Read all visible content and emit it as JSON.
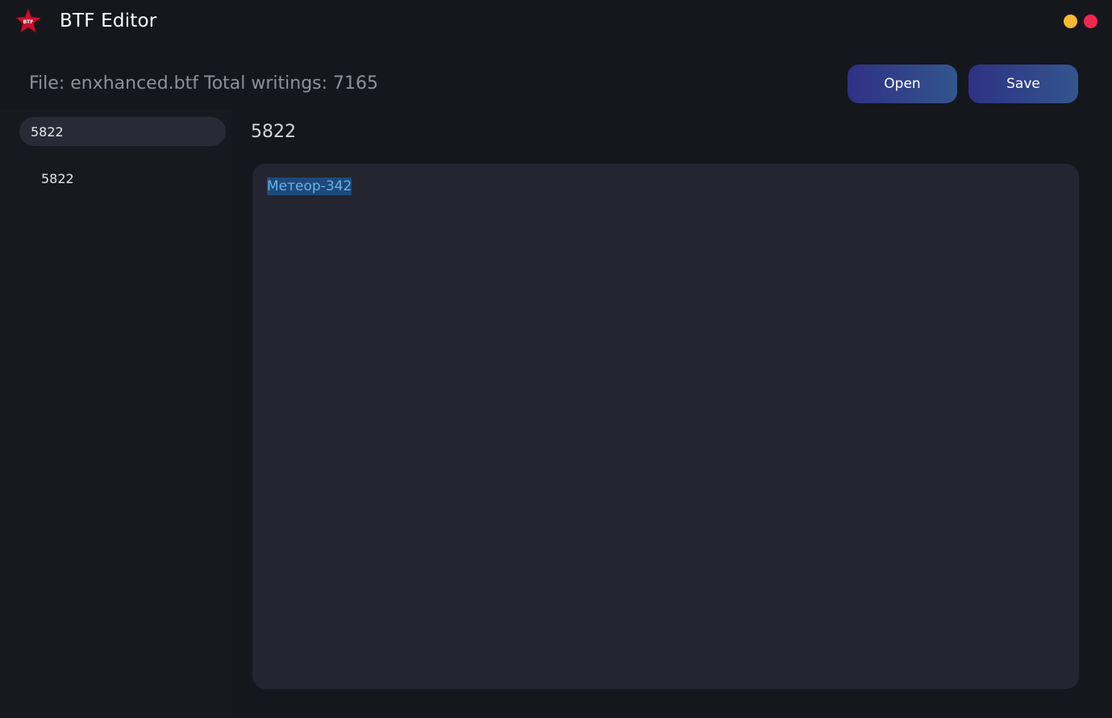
{
  "app": {
    "title": "BTF Editor",
    "logo_text": "BTF"
  },
  "window_controls": {
    "minimize_color": "#f7b731",
    "close_color": "#f0274f"
  },
  "file_info": {
    "file_label": "File: enxhanced.btf",
    "total_label": "Total writings: 7165"
  },
  "toolbar": {
    "open_label": "Open",
    "save_label": "Save"
  },
  "sidebar": {
    "search_value": "5822",
    "items": [
      {
        "label": "5822"
      }
    ]
  },
  "entry": {
    "title": "5822",
    "text": "Метеор-342"
  },
  "colors": {
    "background": "#16171d",
    "panel": "#242531",
    "accent_gradient_start": "#2f3184",
    "accent_gradient_end": "#33558d",
    "selection": "#1d4a7a"
  }
}
